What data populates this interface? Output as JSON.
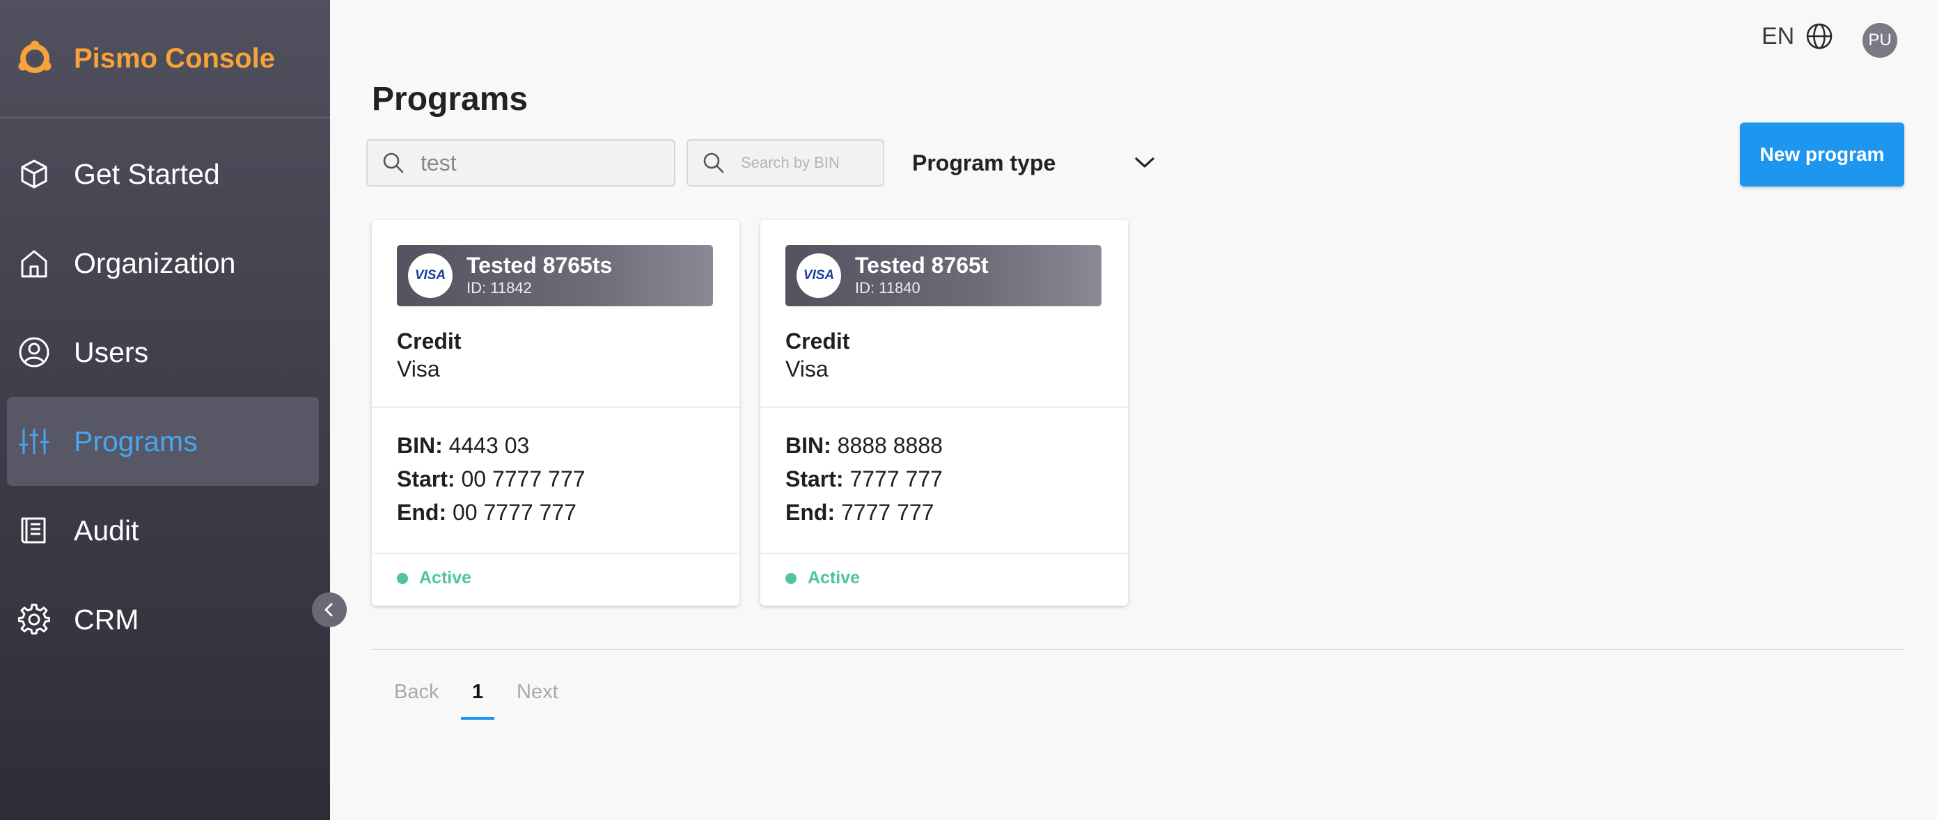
{
  "app": {
    "name": "Pismo Console",
    "brand_color": "#f7a23a",
    "accent_color": "#1e96f0"
  },
  "sidebar": {
    "items": [
      {
        "label": "Get Started",
        "icon": "cube-icon"
      },
      {
        "label": "Organization",
        "icon": "house-icon"
      },
      {
        "label": "Users",
        "icon": "user-circle-icon"
      },
      {
        "label": "Programs",
        "icon": "sliders-icon",
        "active": true
      },
      {
        "label": "Audit",
        "icon": "book-icon"
      },
      {
        "label": "CRM",
        "icon": "gear-icon"
      }
    ]
  },
  "header": {
    "language": "EN",
    "avatar_initials": "PU"
  },
  "main": {
    "title": "Programs",
    "search_value": "test",
    "bin_search_placeholder": "Search by BIN",
    "program_type_label": "Program type",
    "new_program_label": "New program"
  },
  "cards": [
    {
      "name": "Tested 8765ts",
      "id_text": "ID: 11842",
      "card_logo": "VISA",
      "type": "Credit",
      "brand": "Visa",
      "bin_label": "BIN:",
      "bin": "4443 03",
      "start_label": "Start:",
      "start": "00 7777 777",
      "end_label": "End:",
      "end": "00 7777 777",
      "status": "Active"
    },
    {
      "name": "Tested 8765t",
      "id_text": "ID: 11840",
      "card_logo": "VISA",
      "type": "Credit",
      "brand": "Visa",
      "bin_label": "BIN:",
      "bin": "8888 8888",
      "start_label": "Start:",
      "start": "7777 777",
      "end_label": "End:",
      "end": "7777 777",
      "status": "Active"
    }
  ],
  "pagination": {
    "back": "Back",
    "page": "1",
    "next": "Next"
  }
}
